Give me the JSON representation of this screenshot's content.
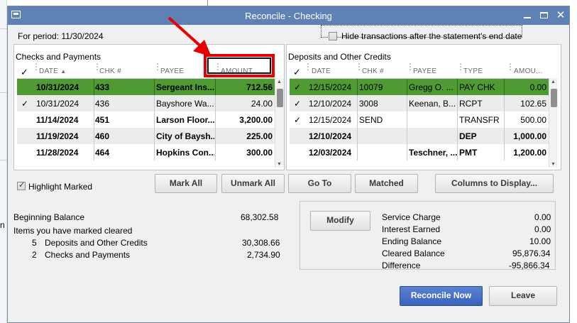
{
  "window": {
    "title": "Reconcile - Checking"
  },
  "period": {
    "label": "For period: 11/30/2024"
  },
  "hide_transactions": {
    "label": "Hide transactions after the statement's end date",
    "checked": false
  },
  "checks": {
    "title": "Checks and Payments",
    "headers": {
      "check": "✓",
      "date": "DATE",
      "chk": "CHK #",
      "payee": "PAYEE",
      "amount": "AMOUNT"
    },
    "rows": [
      {
        "mark": "",
        "date": "10/31/2024",
        "chk": "433",
        "payee": "Sergeant Ins...",
        "amount": "712.56",
        "selected": true,
        "bold": true
      },
      {
        "mark": "✓",
        "date": "10/31/2024",
        "chk": "436",
        "payee": "Bayshore Wa...",
        "amount": "24.00",
        "selected": false,
        "bold": false
      },
      {
        "mark": "",
        "date": "11/14/2024",
        "chk": "451",
        "payee": "Larson Floor...",
        "amount": "3,200.00",
        "selected": false,
        "bold": true
      },
      {
        "mark": "",
        "date": "11/19/2024",
        "chk": "460",
        "payee": "City of Baysh...",
        "amount": "225.00",
        "selected": false,
        "bold": true
      },
      {
        "mark": "",
        "date": "11/28/2024",
        "chk": "464",
        "payee": "Hopkins Con...",
        "amount": "300.00",
        "selected": false,
        "bold": true
      }
    ]
  },
  "deposits": {
    "title": "Deposits and Other Credits",
    "headers": {
      "check": "✓",
      "date": "DATE",
      "chk": "CHK #",
      "payee": "PAYEE",
      "type": "TYPE",
      "amount": "AMOU..."
    },
    "rows": [
      {
        "mark": "✓",
        "date": "12/15/2024",
        "chk": "10079",
        "payee": "Gregg O. ...",
        "type": "PAY CHK",
        "amount": "0.00",
        "selected": true,
        "bold": false
      },
      {
        "mark": "✓",
        "date": "12/10/2024",
        "chk": "3008",
        "payee": "Keenan, B...",
        "type": "RCPT",
        "amount": "102.65",
        "selected": false,
        "bold": false
      },
      {
        "mark": "✓",
        "date": "12/15/2024",
        "chk": "SEND",
        "payee": "",
        "type": "TRANSFR",
        "amount": "500.00",
        "selected": false,
        "bold": false
      },
      {
        "mark": "",
        "date": "12/10/2024",
        "chk": "",
        "payee": "",
        "type": "DEP",
        "amount": "1,000.00",
        "selected": false,
        "bold": true
      },
      {
        "mark": "",
        "date": "12/03/2024",
        "chk": "",
        "payee": "Teschner, ...",
        "type": "PMT",
        "amount": "1,200.00",
        "selected": false,
        "bold": true
      }
    ]
  },
  "highlight_marked": {
    "label": "Highlight Marked",
    "checked": true
  },
  "buttons": {
    "mark_all": "Mark All",
    "unmark_all": "Unmark All",
    "go_to": "Go To",
    "matched": "Matched",
    "columns": "Columns to Display...",
    "modify": "Modify",
    "reconcile_now": "Reconcile Now",
    "leave": "Leave"
  },
  "summary": {
    "beginning_balance_label": "Beginning Balance",
    "beginning_balance": "68,302.58",
    "items_marked_label": "Items you have marked cleared",
    "deposits_count": "5",
    "deposits_label": "Deposits and Other Credits",
    "deposits_total": "30,308.66",
    "checks_count": "2",
    "checks_label": "Checks and Payments",
    "checks_total": "2,734.90"
  },
  "totals": {
    "service_charge_label": "Service Charge",
    "service_charge": "0.00",
    "interest_earned_label": "Interest Earned",
    "interest_earned": "0.00",
    "ending_balance_label": "Ending Balance",
    "ending_balance": "10.00",
    "cleared_balance_label": "Cleared Balance",
    "cleared_balance": "95,876.34",
    "difference_label": "Difference",
    "difference": "-95,866.34"
  },
  "background": {
    "fragment": "n"
  },
  "colors": {
    "title_bar": "#5e82b6",
    "selected_row": "#4f9a33",
    "annotation": "#e60000",
    "primary_button": "#3863bd"
  }
}
